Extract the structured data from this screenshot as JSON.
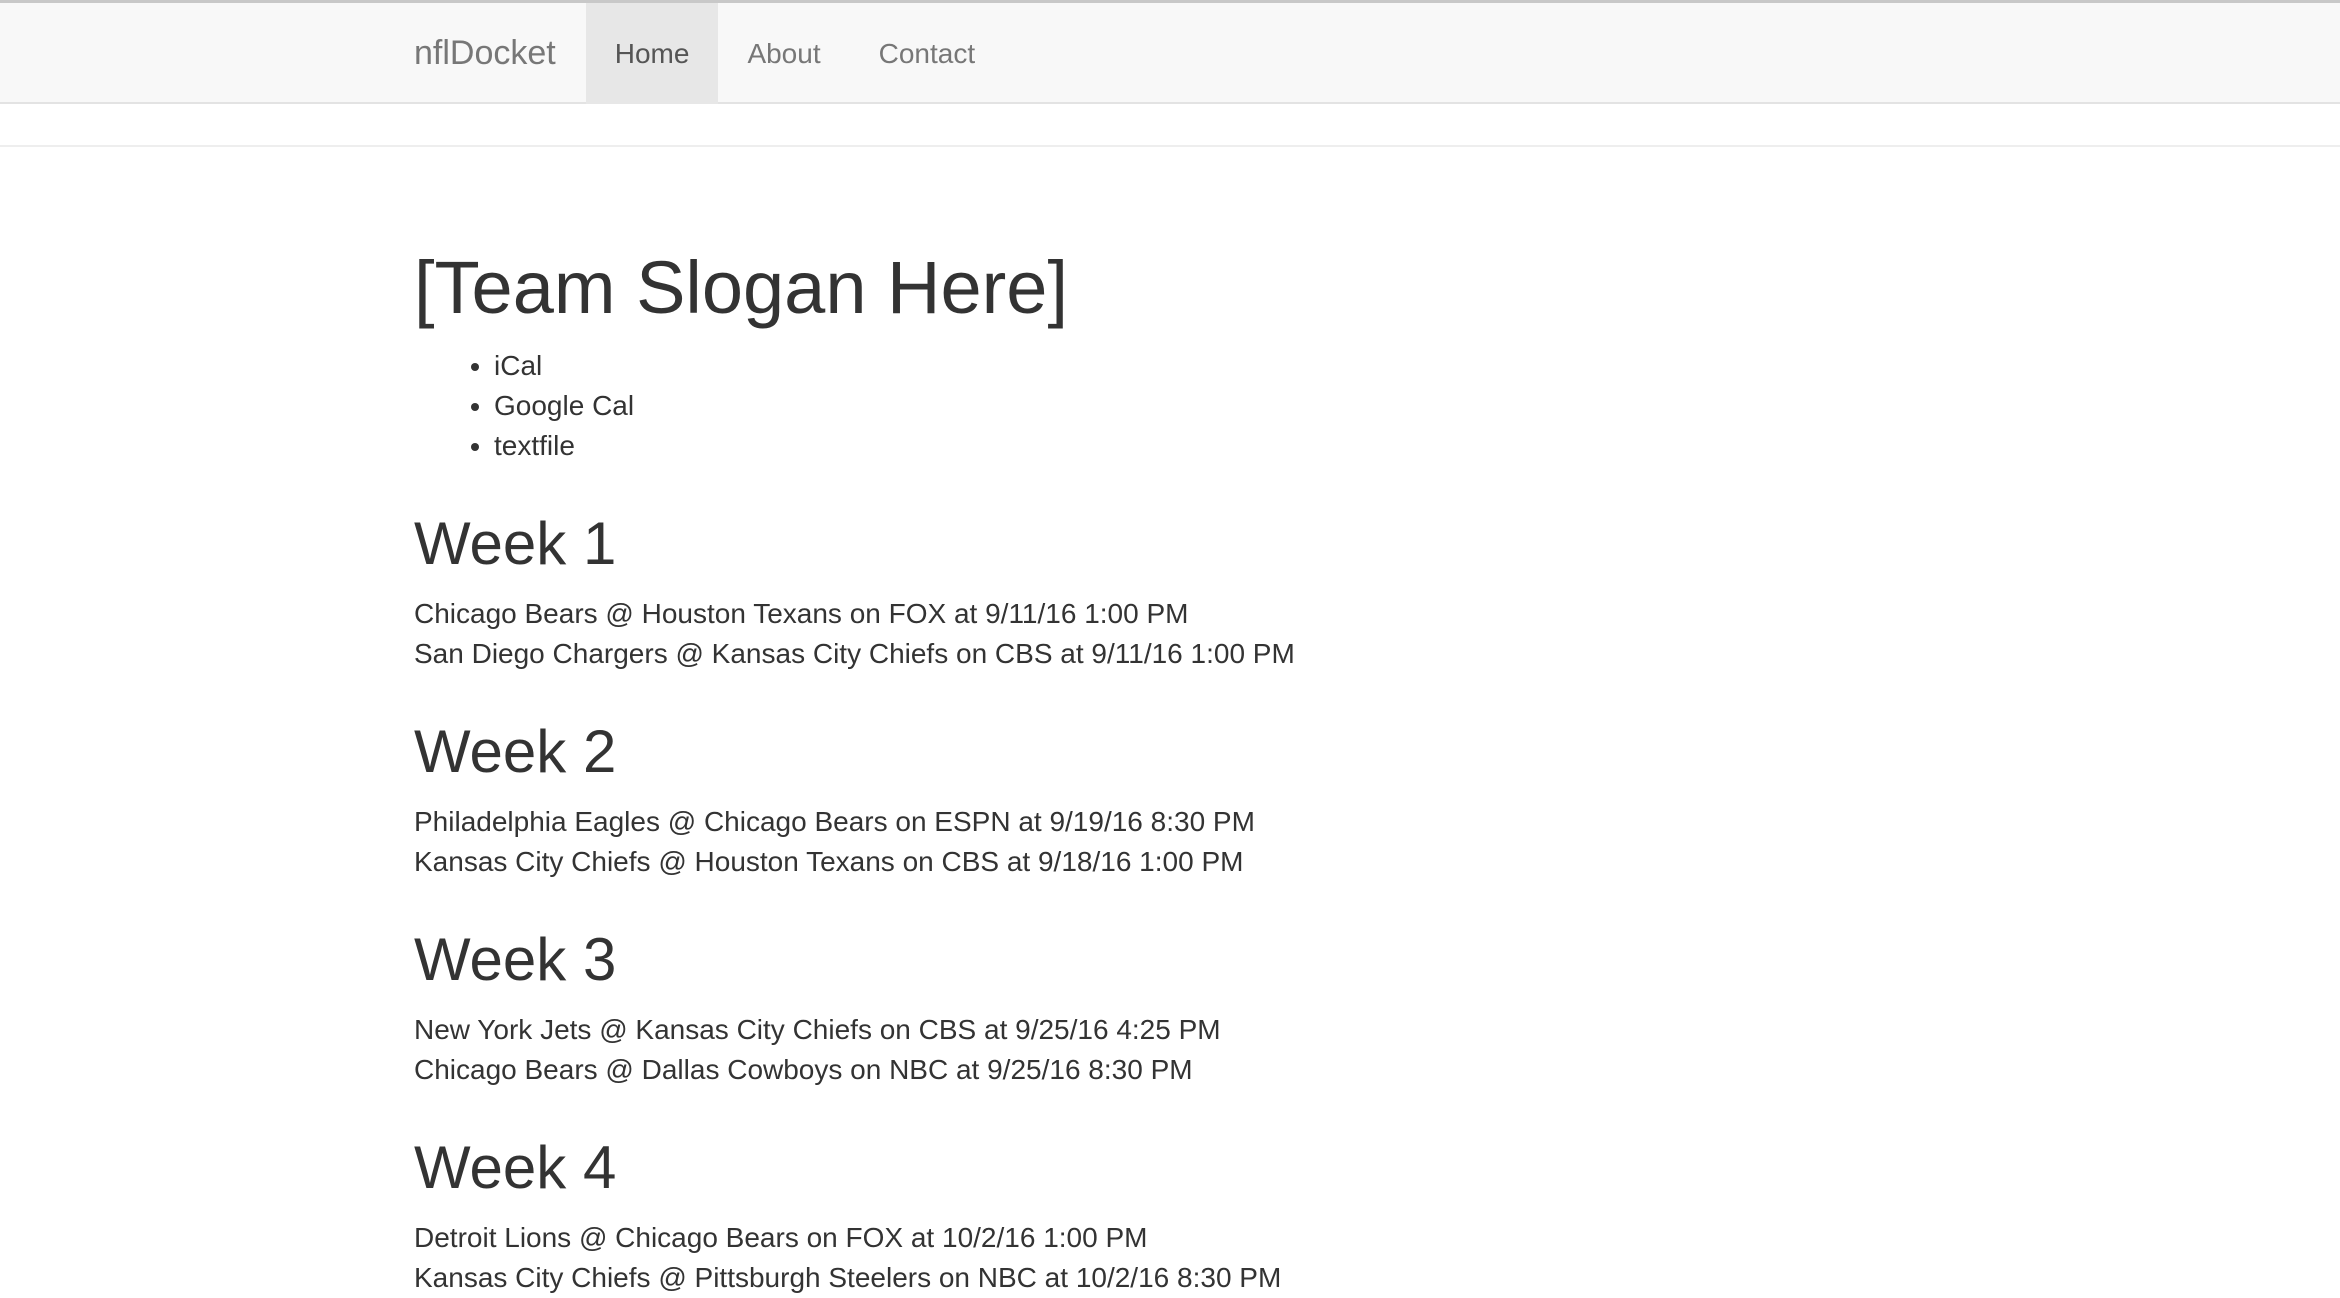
{
  "navbar": {
    "brand": "nflDocket",
    "items": [
      {
        "label": "Home",
        "active": true
      },
      {
        "label": "About",
        "active": false
      },
      {
        "label": "Contact",
        "active": false
      }
    ]
  },
  "main": {
    "slogan": "[Team Slogan Here]",
    "calendar_links": [
      "iCal",
      "Google Cal",
      "textfile"
    ],
    "weeks": [
      {
        "title": "Week 1",
        "games": [
          "Chicago Bears @ Houston Texans on FOX at 9/11/16 1:00 PM",
          "San Diego Chargers @ Kansas City Chiefs on CBS at 9/11/16 1:00 PM"
        ]
      },
      {
        "title": "Week 2",
        "games": [
          "Philadelphia Eagles @ Chicago Bears on ESPN at 9/19/16 8:30 PM",
          "Kansas City Chiefs @ Houston Texans on CBS at 9/18/16 1:00 PM"
        ]
      },
      {
        "title": "Week 3",
        "games": [
          "New York Jets @ Kansas City Chiefs on CBS at 9/25/16 4:25 PM",
          "Chicago Bears @ Dallas Cowboys on NBC at 9/25/16 8:30 PM"
        ]
      },
      {
        "title": "Week 4",
        "games": [
          "Detroit Lions @ Chicago Bears on FOX at 10/2/16 1:00 PM",
          "Kansas City Chiefs @ Pittsburgh Steelers on NBC at 10/2/16 8:30 PM"
        ]
      }
    ]
  }
}
